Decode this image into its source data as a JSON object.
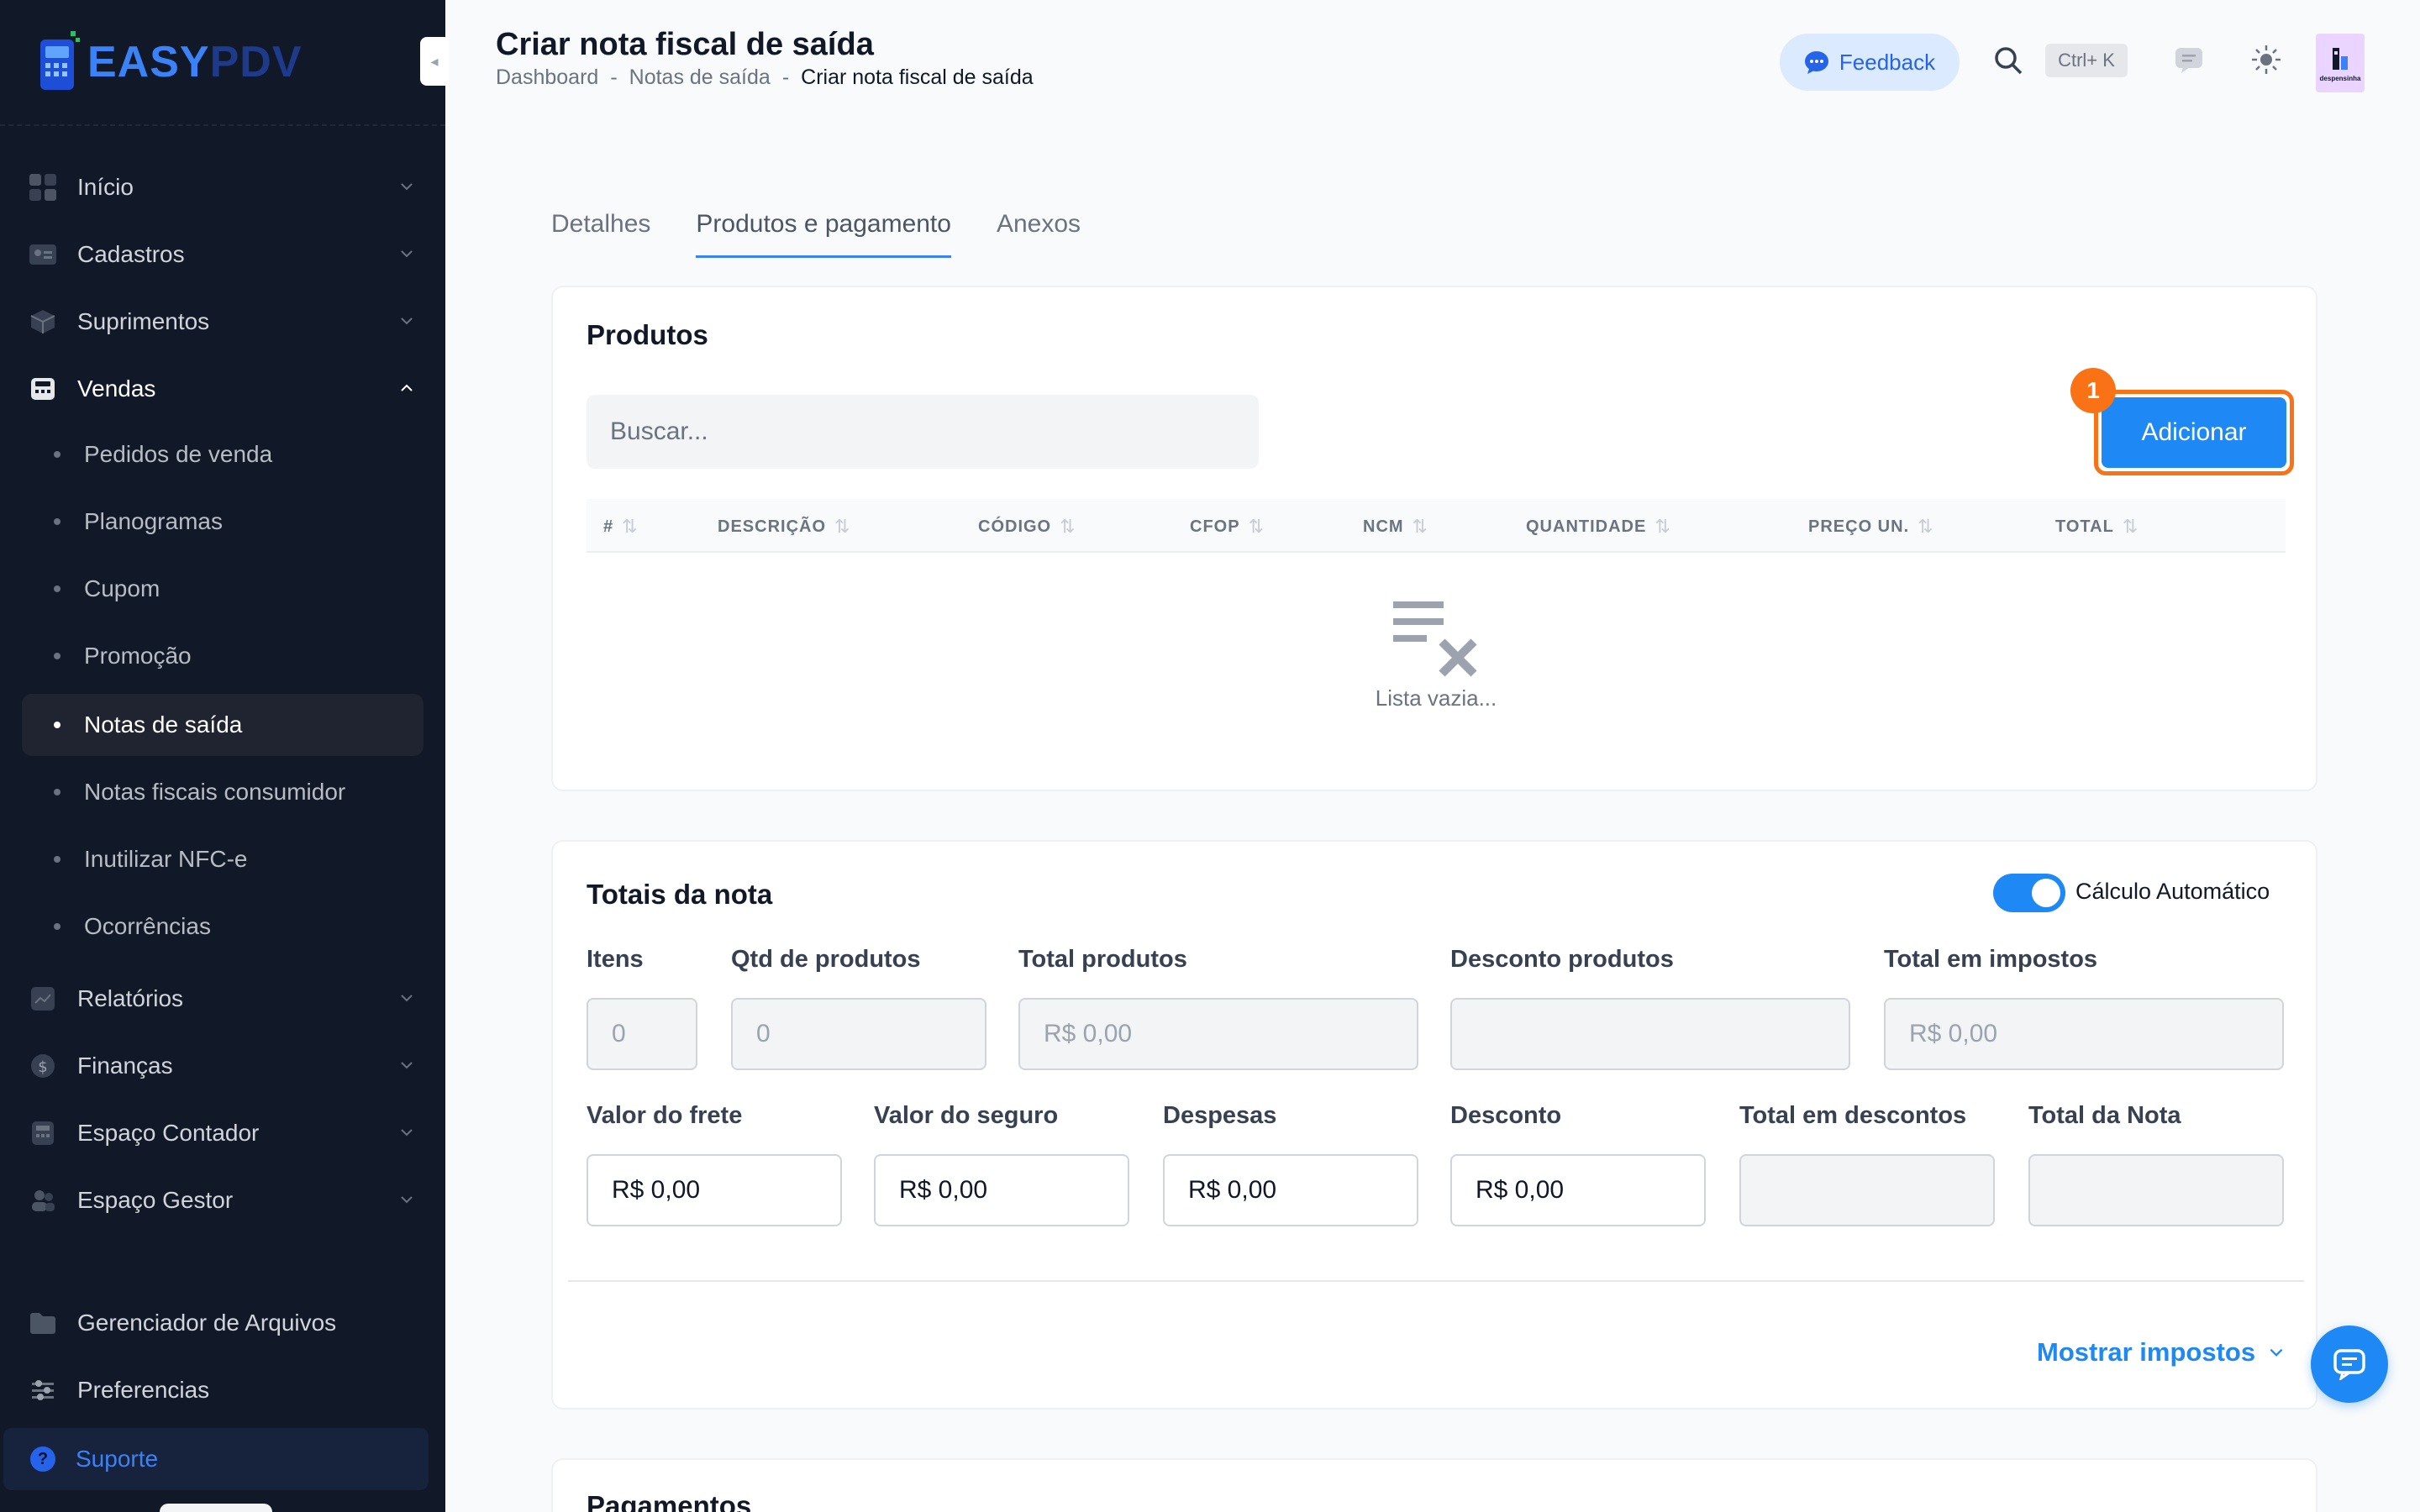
{
  "brand": {
    "logo_text_a": "EASY",
    "logo_text_b": "PDV"
  },
  "header": {
    "title": "Criar nota fiscal de saída",
    "breadcrumb": [
      "Dashboard",
      "Notas de saída",
      "Criar nota fiscal de saída"
    ],
    "feedback_label": "Feedback",
    "search_shortcut": "Ctrl+ K",
    "avatar_text": "despensinha"
  },
  "sidebar": {
    "items": [
      {
        "label": "Início",
        "icon": "grid-icon"
      },
      {
        "label": "Cadastros",
        "icon": "id-card-icon"
      },
      {
        "label": "Suprimentos",
        "icon": "box-icon"
      },
      {
        "label": "Vendas",
        "icon": "cash-register-icon",
        "open": true
      },
      {
        "label": "Relatórios",
        "icon": "chart-icon"
      },
      {
        "label": "Finanças",
        "icon": "dollar-icon"
      },
      {
        "label": "Espaço Contador",
        "icon": "calculator-icon"
      },
      {
        "label": "Espaço Gestor",
        "icon": "people-icon"
      },
      {
        "label": "Gerenciador de Arquivos",
        "icon": "folder-icon"
      },
      {
        "label": "Preferencias",
        "icon": "sliders-icon"
      }
    ],
    "vendas_sub": [
      "Pedidos de venda",
      "Planogramas",
      "Cupom",
      "Promoção",
      "Notas de saída",
      "Notas fiscais consumidor",
      "Inutilizar NFC-e",
      "Ocorrências"
    ],
    "active_sub": "Notas de saída",
    "support_label": "Suporte"
  },
  "tabs": [
    {
      "label": "Detalhes",
      "active": false
    },
    {
      "label": "Produtos e pagamento",
      "active": true
    },
    {
      "label": "Anexos",
      "active": false
    }
  ],
  "produtos": {
    "title": "Produtos",
    "search_placeholder": "Buscar...",
    "add_label": "Adicionar",
    "badge": "1",
    "columns": [
      "#",
      "DESCRIÇÃO",
      "CÓDIGO",
      "CFOP",
      "NCM",
      "QUANTIDADE",
      "PREÇO UN.",
      "TOTAL"
    ],
    "empty_text": "Lista vazia..."
  },
  "totais": {
    "title": "Totais da nota",
    "auto_calc_label": "Cálculo Automático",
    "auto_calc_on": true,
    "row1": [
      {
        "label": "Itens",
        "value": "0"
      },
      {
        "label": "Qtd de produtos",
        "value": "0"
      },
      {
        "label": "Total produtos",
        "value": "R$ 0,00"
      },
      {
        "label": "Desconto produtos",
        "value": ""
      },
      {
        "label": "Total em impostos",
        "value": "R$ 0,00"
      }
    ],
    "row2": [
      {
        "label": "Valor do frete",
        "value": "R$ 0,00"
      },
      {
        "label": "Valor do seguro",
        "value": "R$ 0,00"
      },
      {
        "label": "Despesas",
        "value": "R$ 0,00"
      },
      {
        "label": "Desconto",
        "value": "R$ 0,00"
      },
      {
        "label": "Total em descontos",
        "value": ""
      },
      {
        "label": "Total da Nota",
        "value": ""
      }
    ],
    "show_taxes_label": "Mostrar impostos"
  },
  "pagamentos": {
    "title": "Pagamentos"
  },
  "colors": {
    "accent": "#1e88f5",
    "highlight": "#f97316",
    "sidebar_bg": "#111827"
  }
}
